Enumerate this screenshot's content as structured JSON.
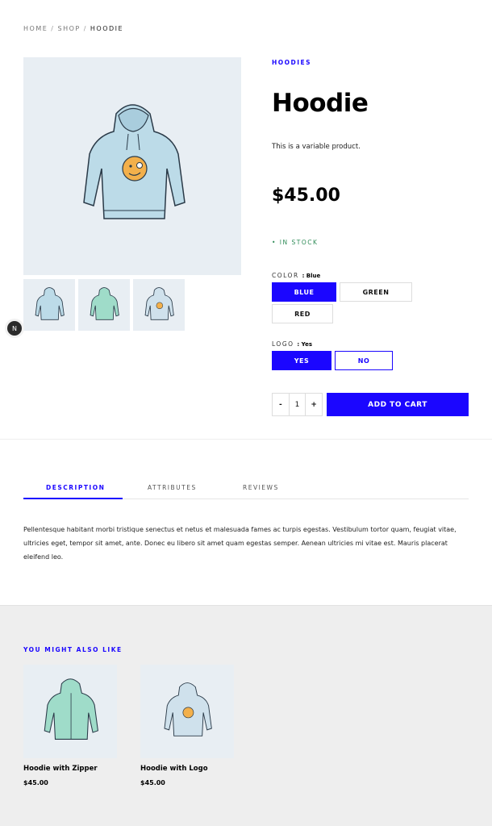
{
  "breadcrumb": {
    "home": "HOME",
    "sep1": "/",
    "shop": "SHOP",
    "sep2": "/",
    "current": "HOODIE"
  },
  "nav_badge": "N",
  "product": {
    "category": "HOODIES",
    "title": "Hoodie",
    "short_description": "This is a variable product.",
    "price": "$45.00",
    "stock": "• IN STOCK"
  },
  "attributes": {
    "color": {
      "label": "COLOR",
      "selected_text": ": Blue",
      "options": [
        "BLUE",
        "GREEN",
        "RED"
      ]
    },
    "logo": {
      "label": "LOGO",
      "selected_text": ": Yes",
      "options": [
        "YES",
        "NO"
      ]
    }
  },
  "cart": {
    "minus": "-",
    "quantity": "1",
    "plus": "+",
    "add_label": "ADD TO CART"
  },
  "tabs": [
    "DESCRIPTION",
    "ATTRIBUTES",
    "REVIEWS"
  ],
  "description": "Pellentesque habitant morbi tristique senectus et netus et malesuada fames ac turpis egestas. Vestibulum tortor quam, feugiat vitae, ultricies eget, tempor sit amet, ante. Donec eu libero sit amet quam egestas semper. Aenean ultricies mi vitae est. Mauris placerat eleifend leo.",
  "related": {
    "title": "YOU MIGHT ALSO LIKE",
    "products": [
      {
        "name": "Hoodie with Zipper",
        "price": "$45.00"
      },
      {
        "name": "Hoodie with Logo",
        "price": "$45.00"
      }
    ]
  },
  "colors": {
    "accent": "#1b06ff",
    "stock": "#2e8b57",
    "hoodie_blue": "#bcdbe8",
    "hoodie_green": "#9fdcc9",
    "image_bg": "#e8eef3"
  }
}
